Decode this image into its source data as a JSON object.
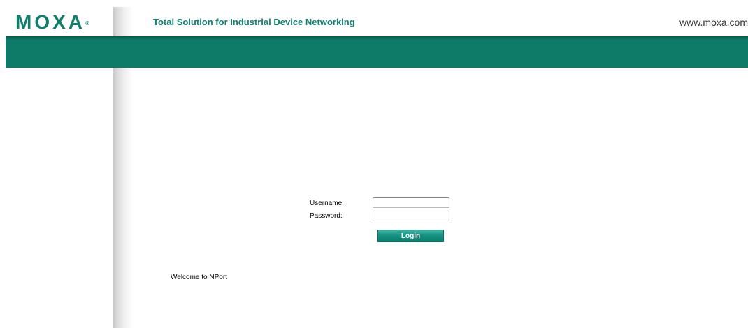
{
  "header": {
    "logo_text": "MOXA",
    "logo_mark": "®",
    "tagline": "Total Solution for Industrial Device Networking",
    "site_url": "www.moxa.com"
  },
  "login": {
    "username_label": "Username:",
    "username_value": "",
    "password_label": "Password:",
    "password_value": "",
    "login_button_label": "Login"
  },
  "footer": {
    "welcome_text": "Welcome to NPort"
  },
  "colors": {
    "brand_teal": "#0e7b68",
    "tagline_teal": "#11806d"
  }
}
